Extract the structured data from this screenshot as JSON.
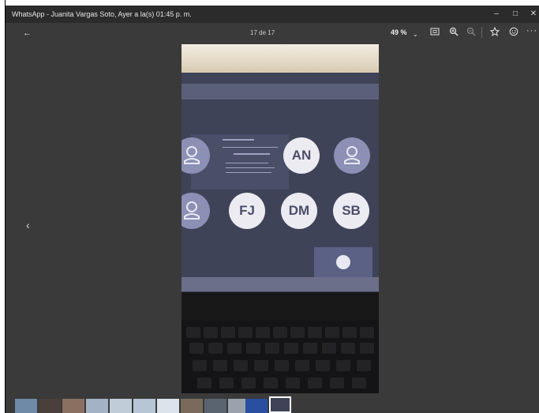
{
  "window": {
    "title": "WhatsApp - Juanita Vargas Soto, Ayer a la(s) 01:45 p. m."
  },
  "toolbar": {
    "counter": "17 de 17",
    "zoom": "49 %"
  },
  "icons": {
    "back": "arrow-left-icon",
    "zoom_dropdown": "chevron-down-icon",
    "fit": "fit-screen-icon",
    "zoom_in": "zoom-in-icon",
    "zoom_out": "zoom-out-icon",
    "star": "star-icon",
    "smiley": "smiley-icon",
    "more": "more-icon",
    "prev": "chevron-left-icon"
  },
  "photo_content": {
    "avatars": [
      {
        "initials": "AN"
      },
      {
        "initials": "FJ"
      },
      {
        "initials": "DM"
      },
      {
        "initials": "SB"
      }
    ]
  }
}
